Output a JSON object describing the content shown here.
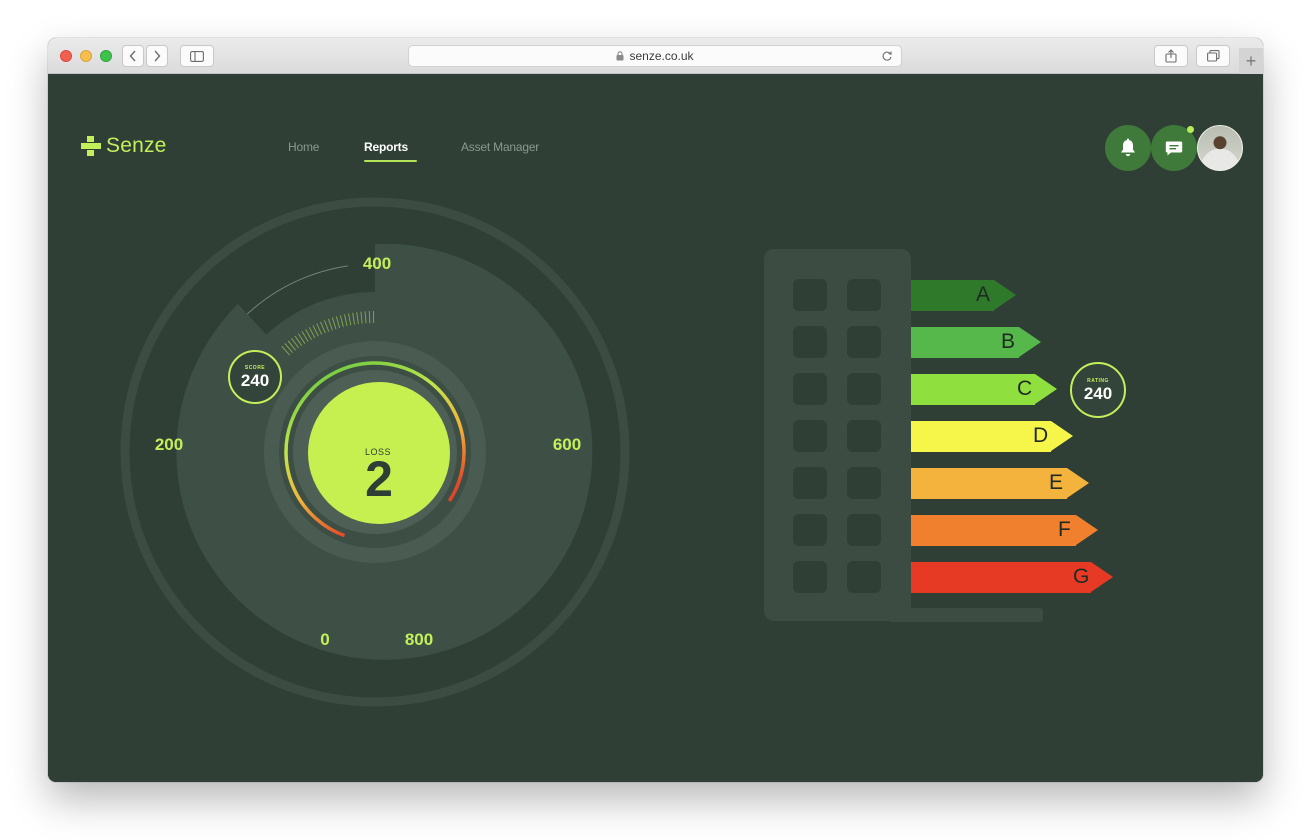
{
  "browser": {
    "url": "senze.co.uk"
  },
  "brand": {
    "name": "Senze",
    "accent": "#c3ef5a",
    "background": "#2f3f36"
  },
  "nav": {
    "items": [
      {
        "label": "Home",
        "active": false
      },
      {
        "label": "Reports",
        "active": true
      },
      {
        "label": "Asset Manager",
        "active": false
      }
    ]
  },
  "header": {
    "icons": [
      "bell-icon",
      "chat-icon"
    ],
    "has_unread_messages": true
  },
  "gauge": {
    "ticks": [
      "400",
      "200",
      "600",
      "0",
      "800"
    ],
    "score_label": "SCORE",
    "score_value": "240",
    "loss_label": "LOSS",
    "loss_value": "2"
  },
  "energy_rating": {
    "bands": [
      {
        "letter": "A",
        "color": "#2f7a2a"
      },
      {
        "letter": "B",
        "color": "#56b84a"
      },
      {
        "letter": "C",
        "color": "#8fe03f"
      },
      {
        "letter": "D",
        "color": "#f6f64a"
      },
      {
        "letter": "E",
        "color": "#f3b33c"
      },
      {
        "letter": "F",
        "color": "#f07f2e"
      },
      {
        "letter": "G",
        "color": "#e63a25"
      }
    ],
    "current_band": "C",
    "rating_label": "RATING",
    "rating_value": "240"
  }
}
